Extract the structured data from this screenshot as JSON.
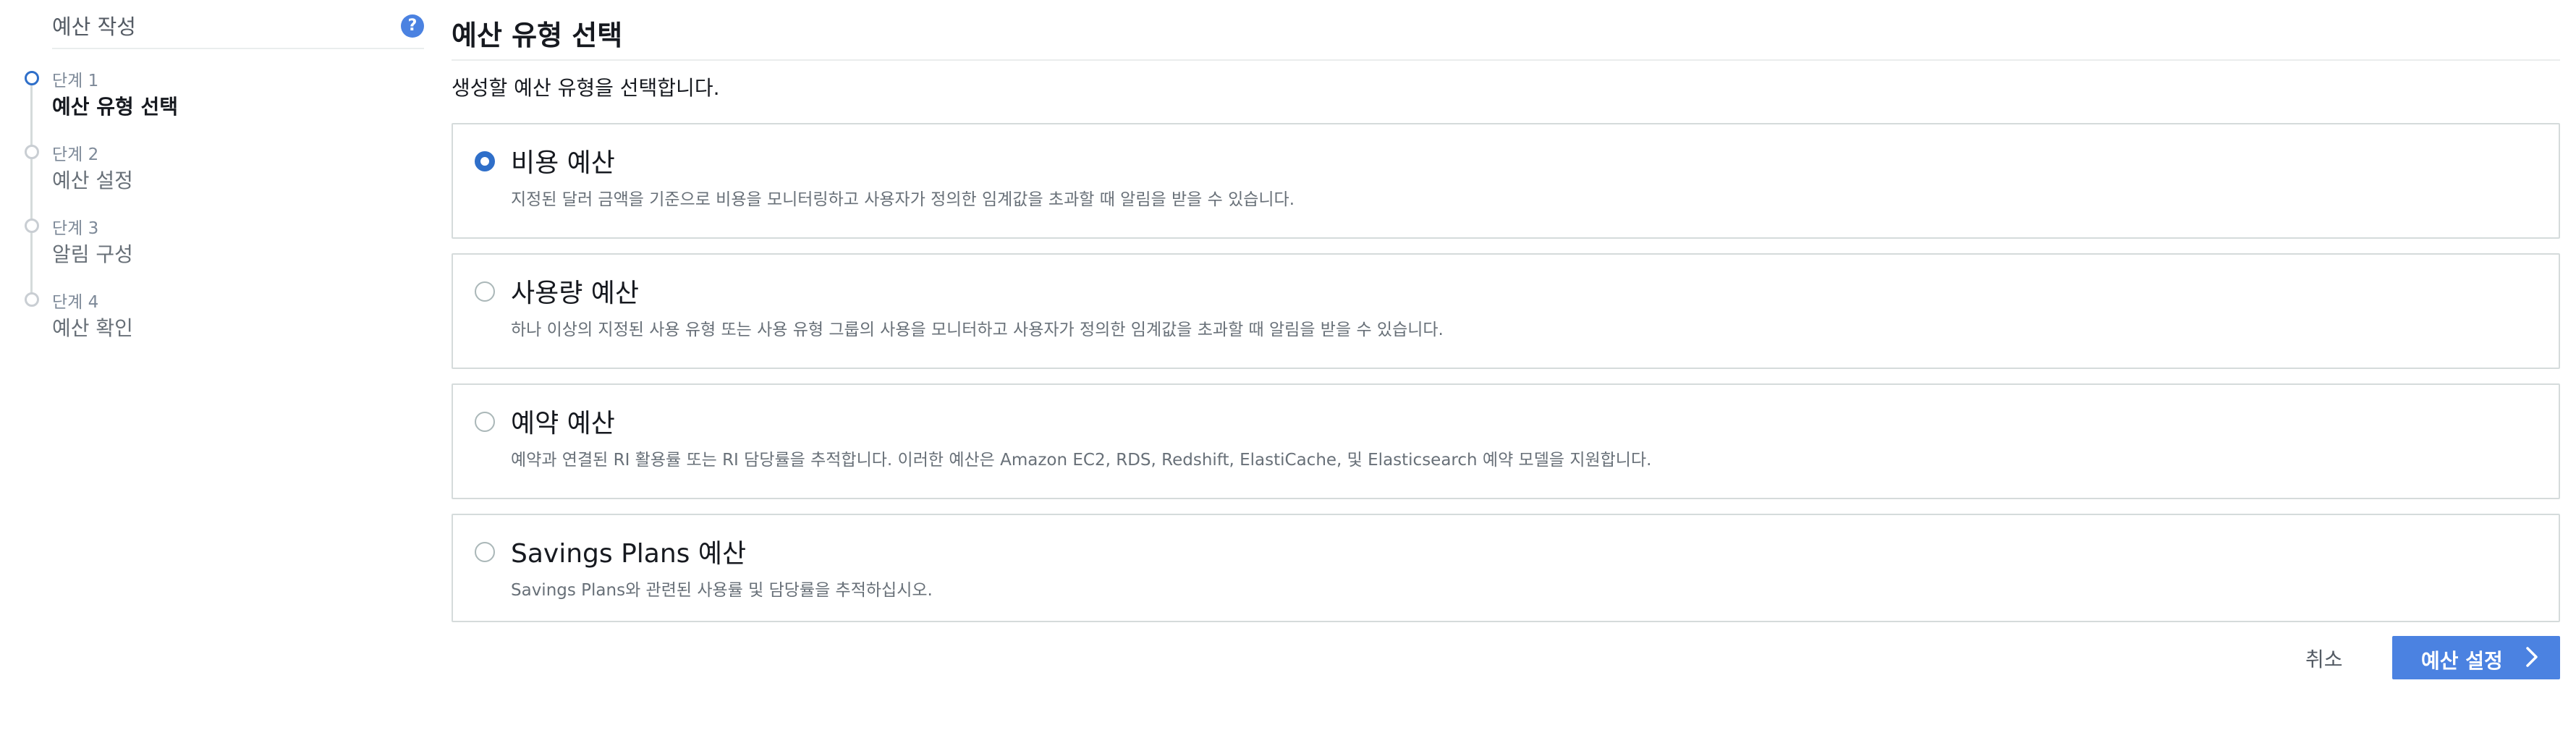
{
  "sidebar": {
    "title": "예산 작성",
    "help_icon": "help-circle-icon",
    "help_glyph": "?",
    "steps": [
      {
        "number": "단계 1",
        "label": "예산 유형 선택",
        "active": true
      },
      {
        "number": "단계 2",
        "label": "예산 설정",
        "active": false
      },
      {
        "number": "단계 3",
        "label": "알림 구성",
        "active": false
      },
      {
        "number": "단계 4",
        "label": "예산 확인",
        "active": false
      }
    ]
  },
  "main": {
    "title": "예산 유형 선택",
    "description": "생성할 예산 유형을 선택합니다.",
    "options": [
      {
        "title": "비용 예산",
        "description": "지정된 달러 금액을 기준으로 비용을 모니터링하고 사용자가 정의한 임계값을 초과할 때 알림을 받을 수 있습니다.",
        "selected": true
      },
      {
        "title": "사용량 예산",
        "description": "하나 이상의 지정된 사용 유형 또는 사용 유형 그룹의 사용을 모니터하고 사용자가 정의한 임계값을 초과할 때 알림을 받을 수 있습니다.",
        "selected": false
      },
      {
        "title": "예약 예산",
        "description": "예약과 연결된 RI 활용률 또는 RI 담당률을 추적합니다. 이러한 예산은 Amazon EC2, RDS, Redshift, ElastiCache, 및 Elasticsearch 예약 모델을 지원합니다.",
        "selected": false
      },
      {
        "title": "Savings Plans 예산",
        "description": "Savings Plans와 관련된 사용률 및 담당률을 추적하십시오.",
        "selected": false
      }
    ]
  },
  "footer": {
    "cancel_label": "취소",
    "next_label": "예산 설정",
    "next_icon": "chevron-right-icon"
  },
  "colors": {
    "accent": "#4b82e1",
    "radio_selected": "#2f6fc9",
    "border": "#d5dbdb"
  }
}
